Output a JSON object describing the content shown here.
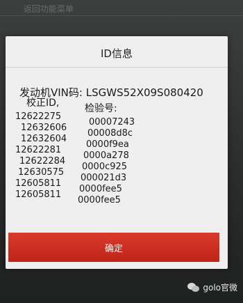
{
  "background": {
    "partial_text": "返回功能菜单"
  },
  "dialog": {
    "title": "ID信息",
    "vin_label": "发动机VIN码:",
    "vin_value": "LSGWS52X09S080420",
    "calibration_header": "校正ID,",
    "check_header": "检验号:",
    "calibration_ids": [
      "12622275",
      "12632606",
      "12632604",
      "12622281",
      "12622284",
      "12630575",
      "12605811",
      "12605811"
    ],
    "check_numbers": [
      "00007243",
      "00008d8c",
      "0000f9ea",
      "0000a278",
      "0000c925",
      "000021d3",
      "0000fee5",
      "0000fee5"
    ],
    "ok_button": "确定"
  },
  "watermark": {
    "text": "golo官微"
  },
  "colors": {
    "button": "#c9301f",
    "dialog_bg": "#efefef"
  }
}
